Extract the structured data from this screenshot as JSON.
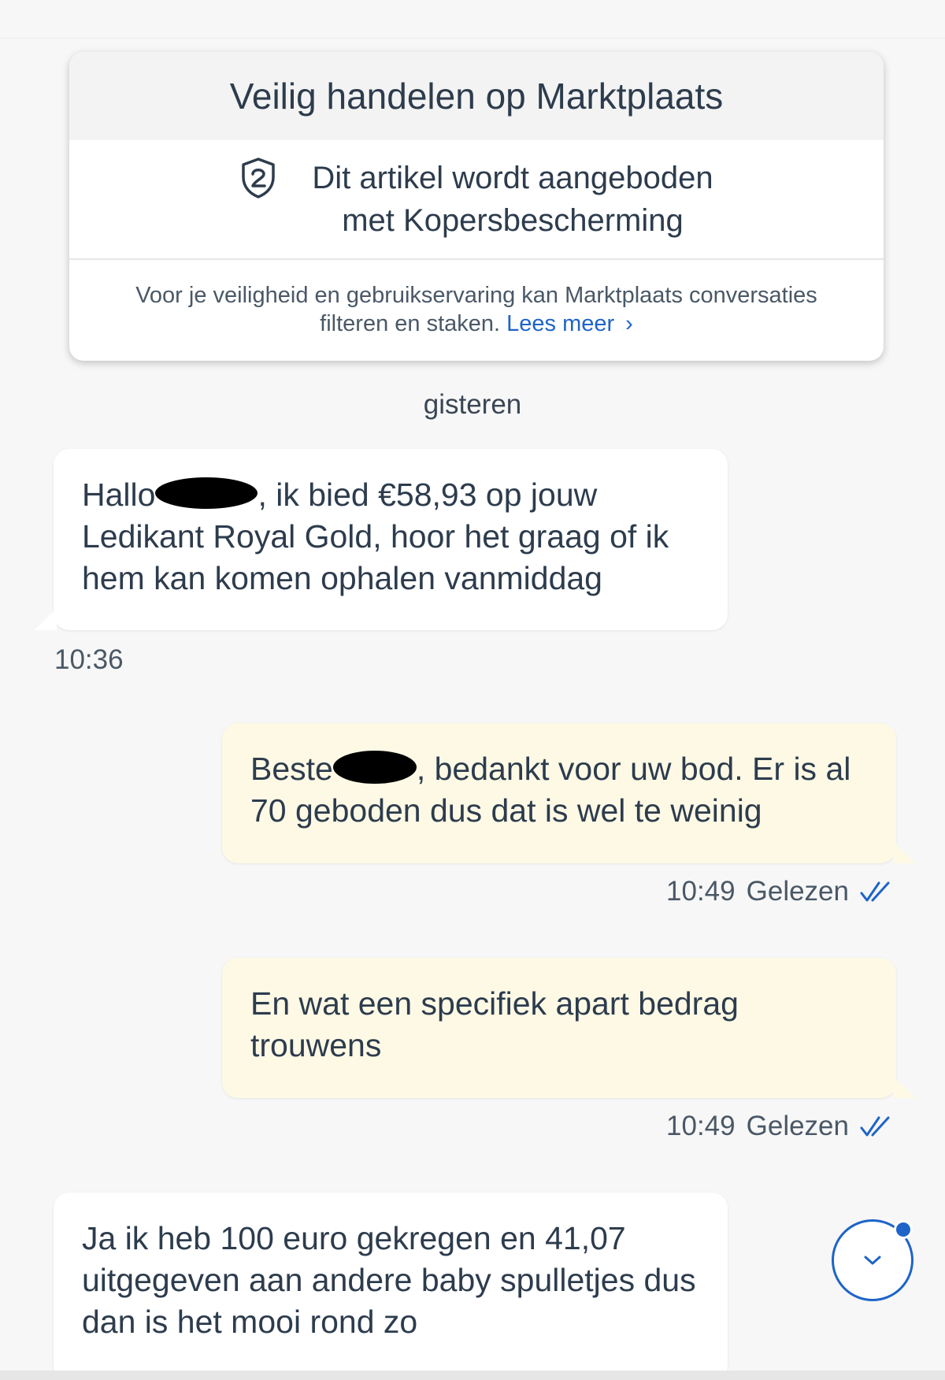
{
  "safety": {
    "title": "Veilig handelen op Marktplaats",
    "protection_line1": "Dit artikel wordt aangeboden",
    "protection_line2": "met Kopersbescherming",
    "footer_text": "Voor je veiligheid en gebruikservaring kan Marktplaats conversaties filteren en staken.",
    "footer_link": "Lees meer",
    "chevron": "›"
  },
  "date_separator": "gisteren",
  "messages": [
    {
      "direction": "in",
      "text_before": "Hallo",
      "text_after": ", ik bied €58,93 op jouw Ledikant Royal Gold, hoor het graag of ik hem kan komen ophalen vanmiddag",
      "time": "10:36"
    },
    {
      "direction": "out",
      "text_before": "Beste",
      "text_after": ", bedankt voor uw bod. Er is al 70 geboden dus dat is wel te weinig",
      "time": "10:49",
      "status": "Gelezen"
    },
    {
      "direction": "out",
      "text": "En wat een specifiek apart bedrag trouwens",
      "time": "10:49",
      "status": "Gelezen"
    },
    {
      "direction": "in",
      "text": "Ja ik heb 100 euro gekregen en 41,07 uitgegeven aan andere baby spulletjes dus dan is het mooi rond zo"
    }
  ],
  "colors": {
    "accent": "#1e64c8",
    "incoming_bubble": "#ffffff",
    "outgoing_bubble": "#fdf9e5",
    "background": "#f7f7f7"
  },
  "icons": {
    "protection": "shield-icon",
    "read": "double-check-icon",
    "scroll": "chevron-down-icon"
  }
}
